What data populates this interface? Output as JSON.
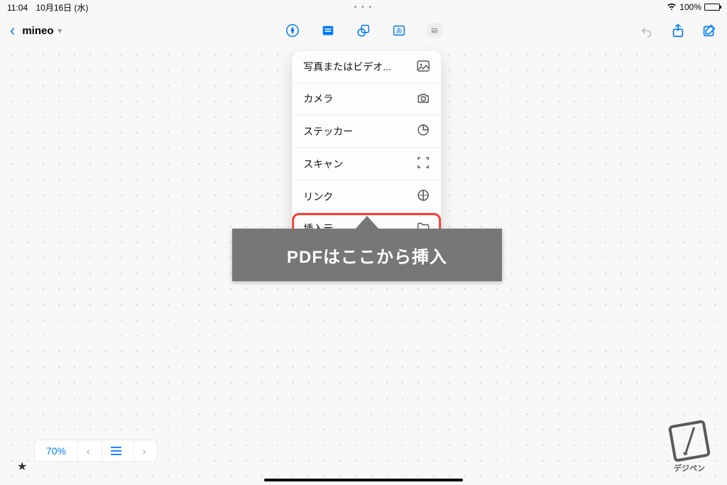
{
  "status": {
    "time": "11:04",
    "date": "10月16日 (水)",
    "dots": "• • •",
    "battery_pct": "100%"
  },
  "header": {
    "doc_title": "mineo"
  },
  "menu": {
    "items": [
      {
        "label": "写真またはビデオ...",
        "icon": "photo"
      },
      {
        "label": "カメラ",
        "icon": "camera"
      },
      {
        "label": "ステッカー",
        "icon": "sticker"
      },
      {
        "label": "スキャン",
        "icon": "scan"
      },
      {
        "label": "リンク",
        "icon": "link"
      },
      {
        "label": "挿入元...",
        "icon": "folder",
        "highlighted": true
      }
    ]
  },
  "callout": {
    "text": "PDFはここから挿入"
  },
  "bottom": {
    "zoom": "70%",
    "prev": "‹",
    "list": "☰",
    "next": "›"
  },
  "watermark": {
    "label": "デジペン"
  },
  "colors": {
    "accent": "#007aff",
    "highlight": "#ff3b30"
  }
}
